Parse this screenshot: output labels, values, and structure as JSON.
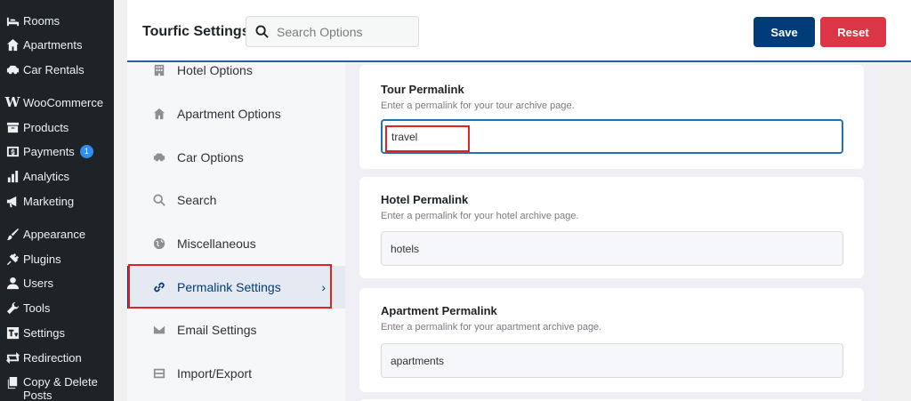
{
  "wp_menu": [
    {
      "label": "Rooms",
      "icon": "bed-icon"
    },
    {
      "label": "Apartments",
      "icon": "home-icon"
    },
    {
      "label": "Car Rentals",
      "icon": "car-icon"
    },
    {
      "label": "WooCommerce",
      "icon": "woocommerce-icon"
    },
    {
      "label": "Products",
      "icon": "archive-icon"
    },
    {
      "label": "Payments",
      "icon": "dollar-icon",
      "badge": "1"
    },
    {
      "label": "Analytics",
      "icon": "chart-bar-icon"
    },
    {
      "label": "Marketing",
      "icon": "megaphone-icon"
    },
    {
      "label": "Appearance",
      "icon": "paintbrush-icon"
    },
    {
      "label": "Plugins",
      "icon": "plug-icon"
    },
    {
      "label": "Users",
      "icon": "user-icon"
    },
    {
      "label": "Tools",
      "icon": "wrench-icon"
    },
    {
      "label": "Settings",
      "icon": "sliders-icon"
    },
    {
      "label": "Redirection",
      "icon": "redirect-icon"
    },
    {
      "label": "Copy & Delete Posts",
      "icon": "copy-icon"
    }
  ],
  "header": {
    "title": "Tourfic Settings",
    "search_placeholder": "Search Options",
    "save_label": "Save",
    "reset_label": "Reset"
  },
  "settings_nav": [
    {
      "label": "Hotel Options",
      "icon": "building-icon"
    },
    {
      "label": "Apartment Options",
      "icon": "home-icon"
    },
    {
      "label": "Car Options",
      "icon": "car-icon"
    },
    {
      "label": "Search",
      "icon": "search-icon"
    },
    {
      "label": "Miscellaneous",
      "icon": "globe-icon"
    },
    {
      "label": "Permalink Settings",
      "icon": "link-icon",
      "active": true
    },
    {
      "label": "Email Settings",
      "icon": "envelope-icon"
    },
    {
      "label": "Import/Export",
      "icon": "database-icon"
    }
  ],
  "permalinks": {
    "tour": {
      "title": "Tour Permalink",
      "desc": "Enter a permalink for your tour archive page.",
      "value": "travel"
    },
    "hotel": {
      "title": "Hotel Permalink",
      "desc": "Enter a permalink for your hotel archive page.",
      "value": "hotels"
    },
    "apartment": {
      "title": "Apartment Permalink",
      "desc": "Enter a permalink for your apartment archive page.",
      "value": "apartments"
    }
  },
  "colors": {
    "sidebar_bg": "#1d2327",
    "primary": "#003c79",
    "reset": "#dc3545",
    "highlight": "#e02424"
  }
}
